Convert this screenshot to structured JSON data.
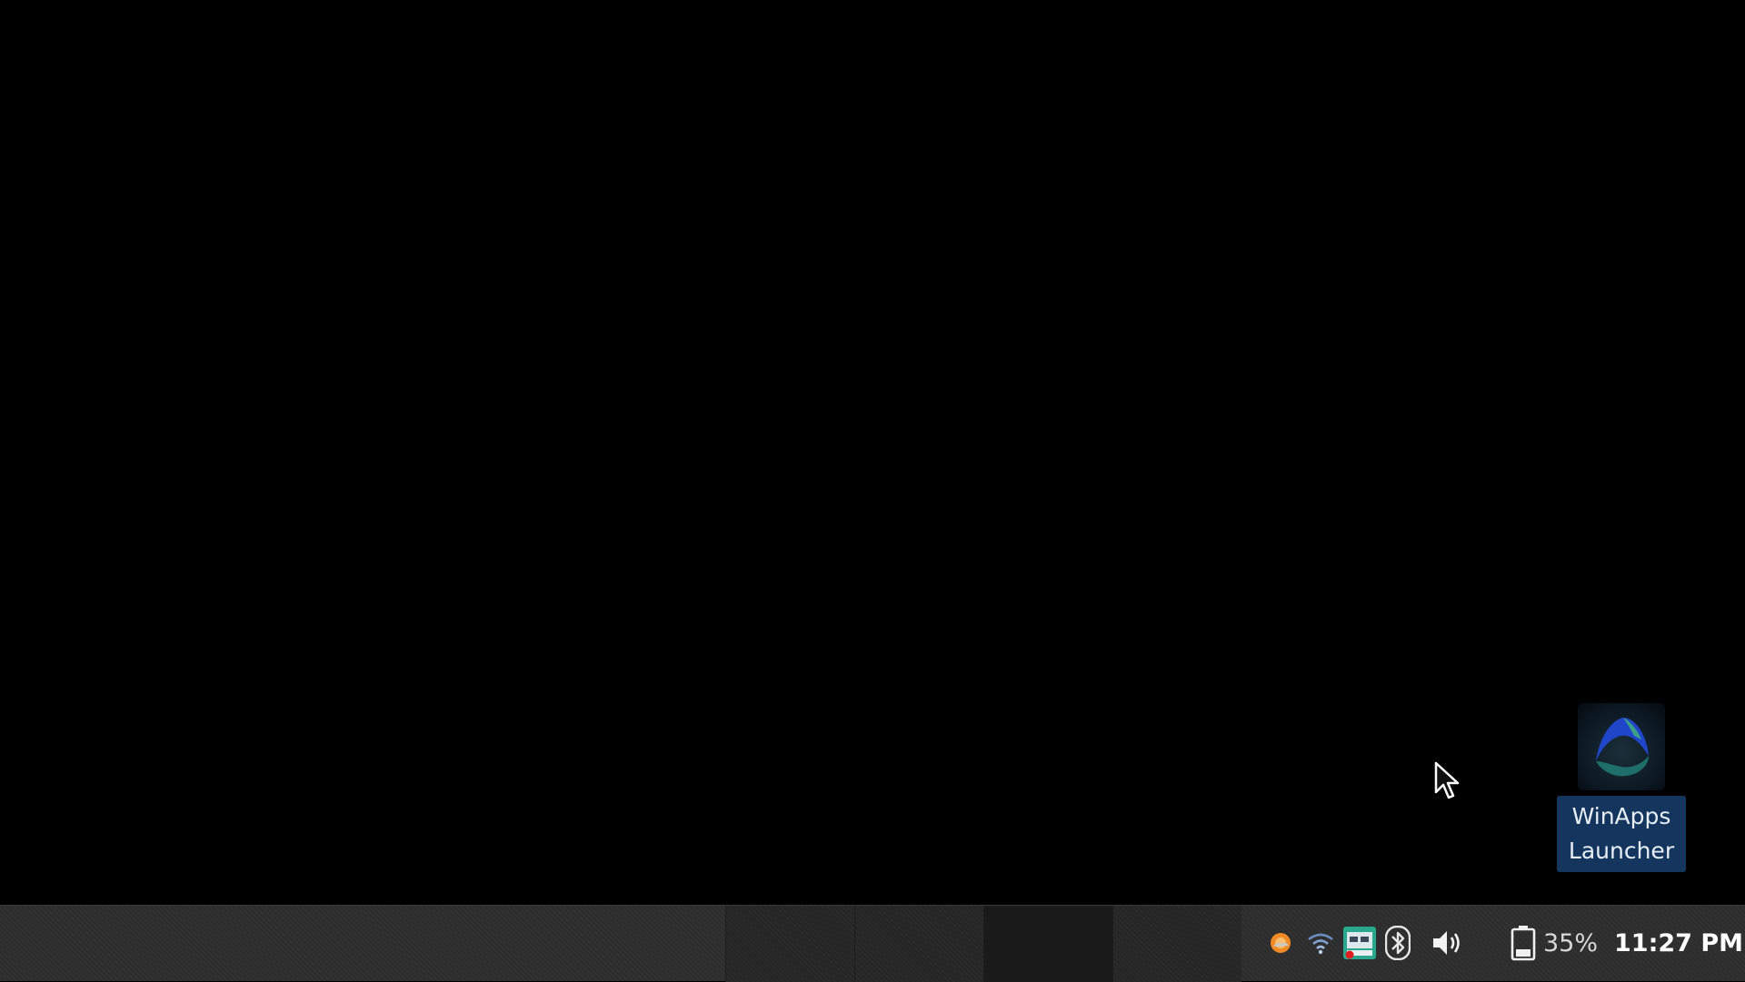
{
  "desktop": {
    "icons": [
      {
        "label": "WinApps\nLauncher",
        "icon": "winapps-launcher-icon"
      }
    ]
  },
  "taskbar": {
    "task_slots": 4,
    "tray": {
      "icons": [
        "weather-icon",
        "wifi-icon",
        "display-manager-icon",
        "bluetooth-icon",
        "volume-icon",
        "battery-icon"
      ],
      "battery_percent": "35%",
      "clock": "11:27 PM"
    }
  },
  "colors": {
    "desktop_background": "#000000",
    "taskbar": "#2d2d2d",
    "icon_label_highlight": "#14355e"
  }
}
